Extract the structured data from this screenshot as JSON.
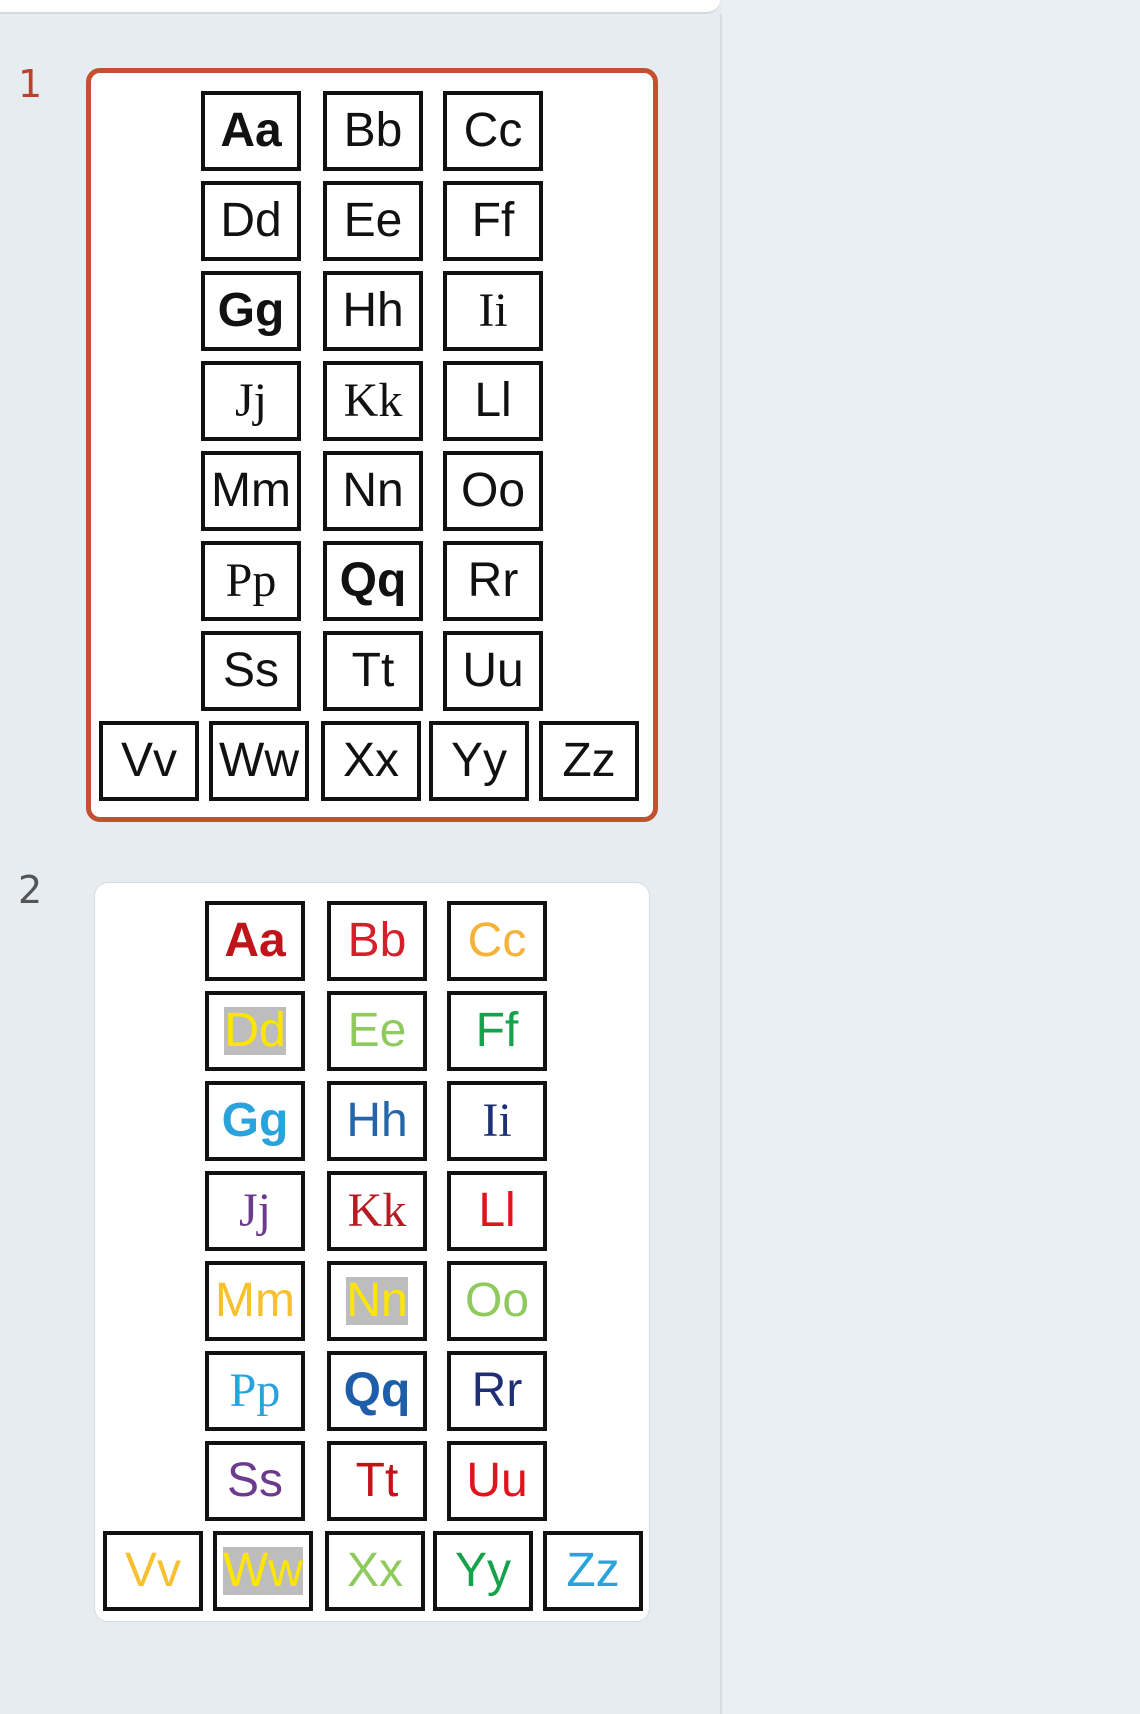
{
  "slides": [
    {
      "number": "1",
      "selected": true,
      "cells": [
        {
          "text": "Aa",
          "color": "#111111",
          "style": "bold"
        },
        {
          "text": "Bb",
          "color": "#111111"
        },
        {
          "text": "Cc",
          "color": "#111111"
        },
        {
          "text": "Dd",
          "color": "#111111"
        },
        {
          "text": "Ee",
          "color": "#111111"
        },
        {
          "text": "Ff",
          "color": "#111111"
        },
        {
          "text": "Gg",
          "color": "#111111",
          "style": "bold"
        },
        {
          "text": "Hh",
          "color": "#111111"
        },
        {
          "text": "Ii",
          "color": "#111111",
          "style": "serif"
        },
        {
          "text": "Jj",
          "color": "#111111",
          "style": "serif"
        },
        {
          "text": "Kk",
          "color": "#111111",
          "style": "serif"
        },
        {
          "text": "Ll",
          "color": "#111111"
        },
        {
          "text": "Mm",
          "color": "#111111"
        },
        {
          "text": "Nn",
          "color": "#111111"
        },
        {
          "text": "Oo",
          "color": "#111111"
        },
        {
          "text": "Pp",
          "color": "#111111",
          "style": "serif"
        },
        {
          "text": "Qq",
          "color": "#111111",
          "style": "bold"
        },
        {
          "text": "Rr",
          "color": "#111111"
        },
        {
          "text": "Ss",
          "color": "#111111"
        },
        {
          "text": "Tt",
          "color": "#111111"
        },
        {
          "text": "Uu",
          "color": "#111111"
        },
        {
          "text": "Vv",
          "color": "#111111"
        },
        {
          "text": "Ww",
          "color": "#111111"
        },
        {
          "text": "Xx",
          "color": "#111111"
        },
        {
          "text": "Yy",
          "color": "#111111"
        },
        {
          "text": "Zz",
          "color": "#111111"
        }
      ]
    },
    {
      "number": "2",
      "selected": false,
      "cells": [
        {
          "text": "Aa",
          "color": "#c0131a",
          "style": "bold"
        },
        {
          "text": "Bb",
          "color": "#d4202a"
        },
        {
          "text": "Cc",
          "color": "#f4b23a"
        },
        {
          "text": "Dd",
          "color": "#ffe600",
          "highlight": true
        },
        {
          "text": "Ee",
          "color": "#8fca5e"
        },
        {
          "text": "Ff",
          "color": "#16a24b"
        },
        {
          "text": "Gg",
          "color": "#2aa3dc",
          "style": "bold"
        },
        {
          "text": "Hh",
          "color": "#2466a8"
        },
        {
          "text": "Ii",
          "color": "#1f2f75",
          "style": "serif"
        },
        {
          "text": "Jj",
          "color": "#6c3b8e",
          "style": "serif"
        },
        {
          "text": "Kk",
          "color": "#b51d22",
          "style": "serif"
        },
        {
          "text": "Ll",
          "color": "#e0141c"
        },
        {
          "text": "Mm",
          "color": "#f6c02e"
        },
        {
          "text": "Nn",
          "color": "#ffe600",
          "highlight": true
        },
        {
          "text": "Oo",
          "color": "#8fca5e"
        },
        {
          "text": "Pp",
          "color": "#2aa3dc",
          "style": "serif"
        },
        {
          "text": "Qq",
          "color": "#1e5ea8",
          "style": "bold"
        },
        {
          "text": "Rr",
          "color": "#1f2f75"
        },
        {
          "text": "Ss",
          "color": "#6c3b8e"
        },
        {
          "text": "Tt",
          "color": "#c0131a"
        },
        {
          "text": "Uu",
          "color": "#e0141c"
        },
        {
          "text": "Vv",
          "color": "#f6c02e"
        },
        {
          "text": "Ww",
          "color": "#ffe600",
          "highlight": true
        },
        {
          "text": "Xx",
          "color": "#8fca5e"
        },
        {
          "text": "Yy",
          "color": "#16a24b"
        },
        {
          "text": "Zz",
          "color": "#2aa3dc"
        }
      ]
    }
  ]
}
